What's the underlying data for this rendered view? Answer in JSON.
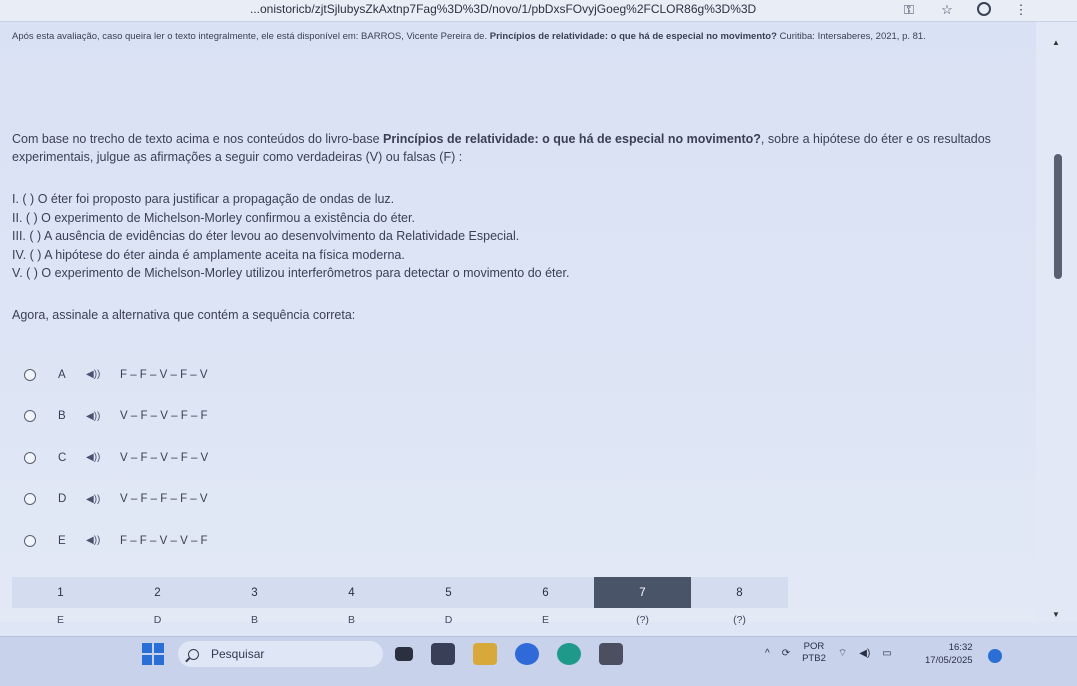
{
  "browser": {
    "url": "...onistoricb/zjtSjlubysZkAxtnp7Fag%3D%3D/novo/1/pbDxsFOvyjGoeg%2FCLOR86g%3D%3D"
  },
  "reference": {
    "prefix": "Após esta avaliação, caso queira ler o texto integralmente, ele está disponível em: BARROS, Vicente Pereira de.",
    "bold": "Princípios de relatividade: o que há de especial no movimento?",
    "suffix": "Curitiba: Intersaberes, 2021, p. 81."
  },
  "question": {
    "intro_a": "Com base no trecho de texto acima e nos conteúdos do livro-base ",
    "intro_bold": "Princípios de relatividade: o que há de especial no movimento?",
    "intro_b": ", sobre a hipótese do éter e os resultados experimentais, julgue as afirmações a seguir como verdadeiras (V) ou falsas (F) :",
    "statements": [
      "I. ( ) O éter foi proposto para justificar a propagação de ondas de luz.",
      "II. ( ) O experimento de Michelson-Morley confirmou a existência do éter.",
      "III. ( ) A ausência de evidências do éter levou ao desenvolvimento da Relatividade Especial.",
      "IV. ( ) A hipótese do éter ainda é amplamente aceita na física moderna.",
      "V. ( ) O experimento de Michelson-Morley utilizou interferômetros para detectar o movimento do éter."
    ],
    "ask": "Agora, assinale a alternativa que contém a sequência correta:"
  },
  "options": [
    {
      "letter": "A",
      "text": "F – F – V – F – V"
    },
    {
      "letter": "B",
      "text": "V – F – V – F – F"
    },
    {
      "letter": "C",
      "text": "V – F – V – F – V"
    },
    {
      "letter": "D",
      "text": "V – F – F – F – V"
    },
    {
      "letter": "E",
      "text": "F – F – V – V – F"
    }
  ],
  "answer_grid": {
    "numbers": [
      "1",
      "2",
      "3",
      "4",
      "5",
      "6",
      "7",
      "8"
    ],
    "answers": [
      "E",
      "D",
      "B",
      "B",
      "D",
      "E",
      "(?)",
      "(?)"
    ],
    "active_index": 6
  },
  "taskbar": {
    "search_label": "Pesquisar",
    "lang_top": "POR",
    "lang_bottom": "PTB2",
    "time": "16:32",
    "date": "17/05/2025"
  },
  "colors": {
    "active_cell": "#4a5468",
    "page_bg": "#dde5f5",
    "windows_blue": "#2a6fd6"
  }
}
